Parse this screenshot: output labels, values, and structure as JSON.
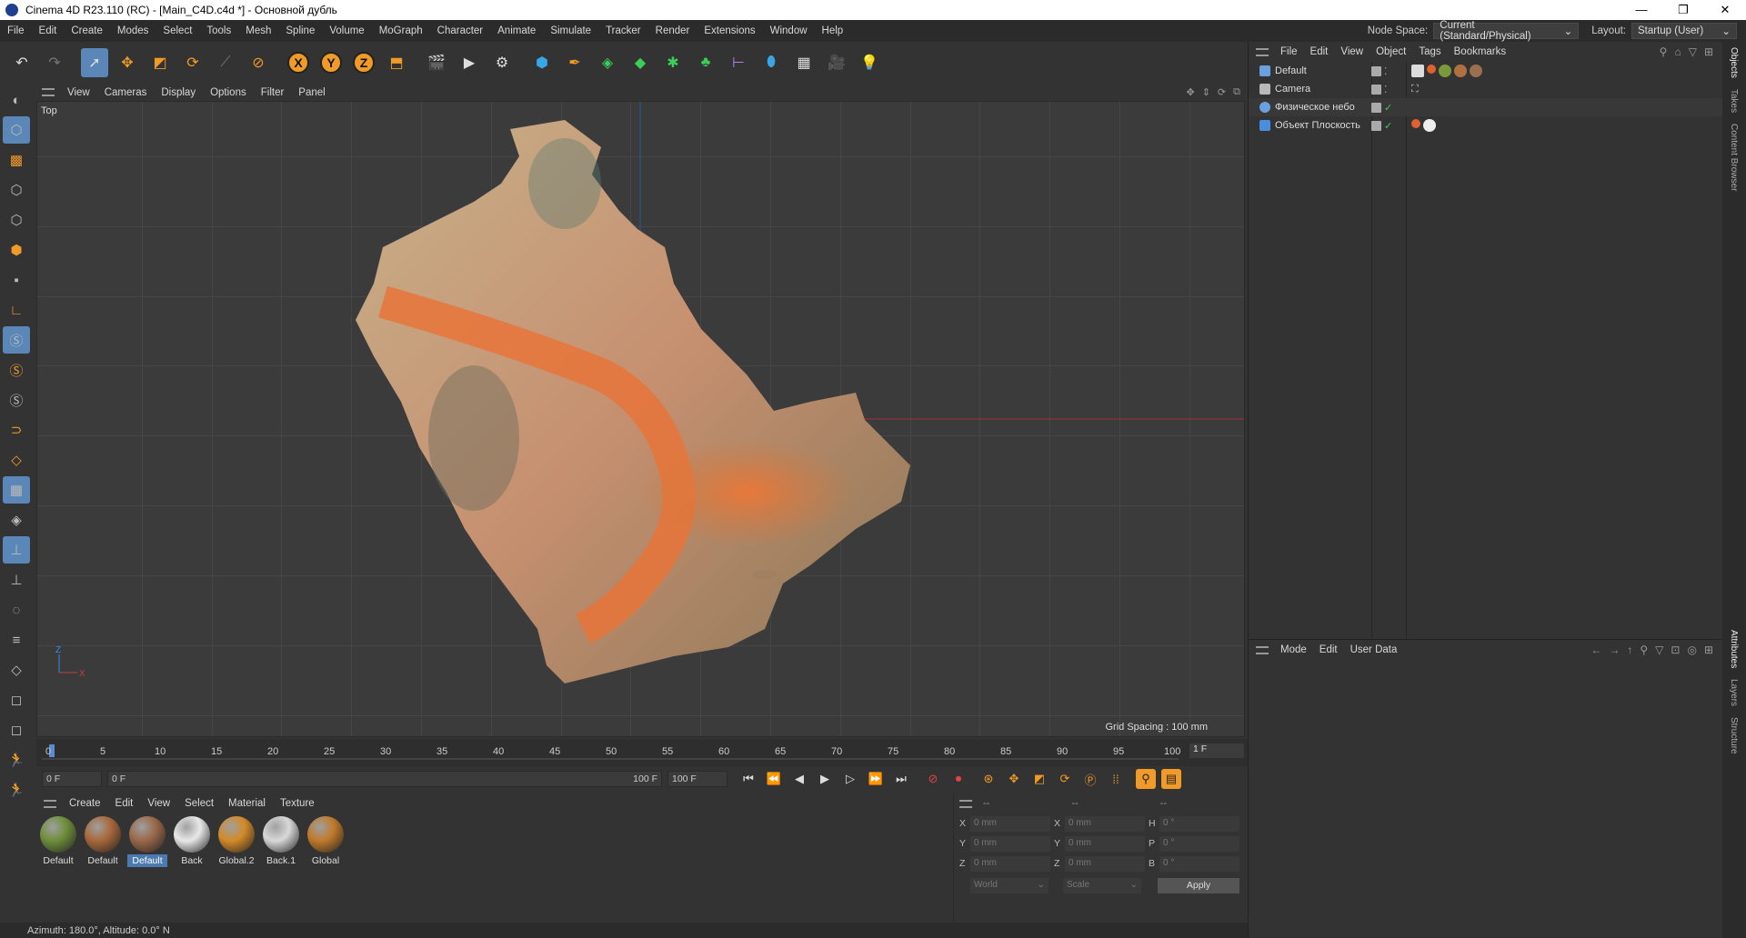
{
  "window": {
    "title": "Cinema 4D R23.110 (RC) - [Main_C4D.c4d *] - Основной дубль",
    "minimize": "—",
    "maximize": "❐",
    "close": "✕"
  },
  "menu": {
    "items": [
      "File",
      "Edit",
      "Create",
      "Modes",
      "Select",
      "Tools",
      "Mesh",
      "Spline",
      "Volume",
      "MoGraph",
      "Character",
      "Animate",
      "Simulate",
      "Tracker",
      "Render",
      "Extensions",
      "Window",
      "Help"
    ],
    "node_space_label": "Node Space:",
    "node_space_value": "Current (Standard/Physical)",
    "layout_label": "Layout:",
    "layout_value": "Startup (User)"
  },
  "viewport": {
    "menu": [
      "View",
      "Cameras",
      "Display",
      "Options",
      "Filter",
      "Panel"
    ],
    "label": "Top",
    "grid_spacing": "Grid Spacing : 100 mm",
    "axis_z": "Z",
    "axis_x": "X"
  },
  "timeline": {
    "ticks": [
      "0",
      "5",
      "10",
      "15",
      "20",
      "25",
      "30",
      "35",
      "40",
      "45",
      "50",
      "55",
      "60",
      "65",
      "70",
      "75",
      "80",
      "85",
      "90",
      "95",
      "100"
    ],
    "current_frame": "1 F",
    "start": "0 F",
    "preview_start": "0 F",
    "preview_end": "100 F",
    "end": "100 F"
  },
  "materials": {
    "menu": [
      "Create",
      "Edit",
      "View",
      "Select",
      "Material",
      "Texture"
    ],
    "items": [
      {
        "name": "Default",
        "color": "#6e8e3a",
        "selected": false
      },
      {
        "name": "Default",
        "color": "#a8683a",
        "selected": false
      },
      {
        "name": "Default",
        "color": "#9a6848",
        "selected": true
      },
      {
        "name": "Back",
        "color": "#e8e8e8",
        "selected": false
      },
      {
        "name": "Global.2",
        "color": "#d48a28",
        "selected": false
      },
      {
        "name": "Back.1",
        "color": "#d8d8d8",
        "selected": false
      },
      {
        "name": "Global",
        "color": "#c07a2a",
        "selected": false
      }
    ]
  },
  "coords": {
    "header": [
      "--",
      "--",
      "--"
    ],
    "rows": [
      {
        "a1": "X",
        "v1": "0 mm",
        "a2": "X",
        "v2": "0 mm",
        "a3": "H",
        "v3": "0 °"
      },
      {
        "a1": "Y",
        "v1": "0 mm",
        "a2": "Y",
        "v2": "0 mm",
        "a3": "P",
        "v3": "0 °"
      },
      {
        "a1": "Z",
        "v1": "0 mm",
        "a2": "Z",
        "v2": "0 mm",
        "a3": "B",
        "v3": "0 °"
      }
    ],
    "space": "World",
    "mode": "Scale",
    "apply": "Apply"
  },
  "objects": {
    "menu": [
      "File",
      "Edit",
      "View",
      "Object",
      "Tags",
      "Bookmarks"
    ],
    "rows": [
      {
        "name": "Default",
        "icon_color": "#6aa0e0"
      },
      {
        "name": "Camera",
        "icon_color": "#b8b8b8"
      },
      {
        "name": "Физическое небо",
        "icon_color": "#6aa0e0"
      },
      {
        "name": "Объект Плоскость",
        "icon_color": "#4a8ee0"
      }
    ]
  },
  "attributes": {
    "menu": [
      "Mode",
      "Edit",
      "User Data"
    ]
  },
  "sidetabs": [
    "Objects",
    "Takes",
    "Content Browser",
    "Attributes",
    "Layers",
    "Structure"
  ],
  "status": "Azimuth: 180.0°, Altitude: 0.0°  N"
}
